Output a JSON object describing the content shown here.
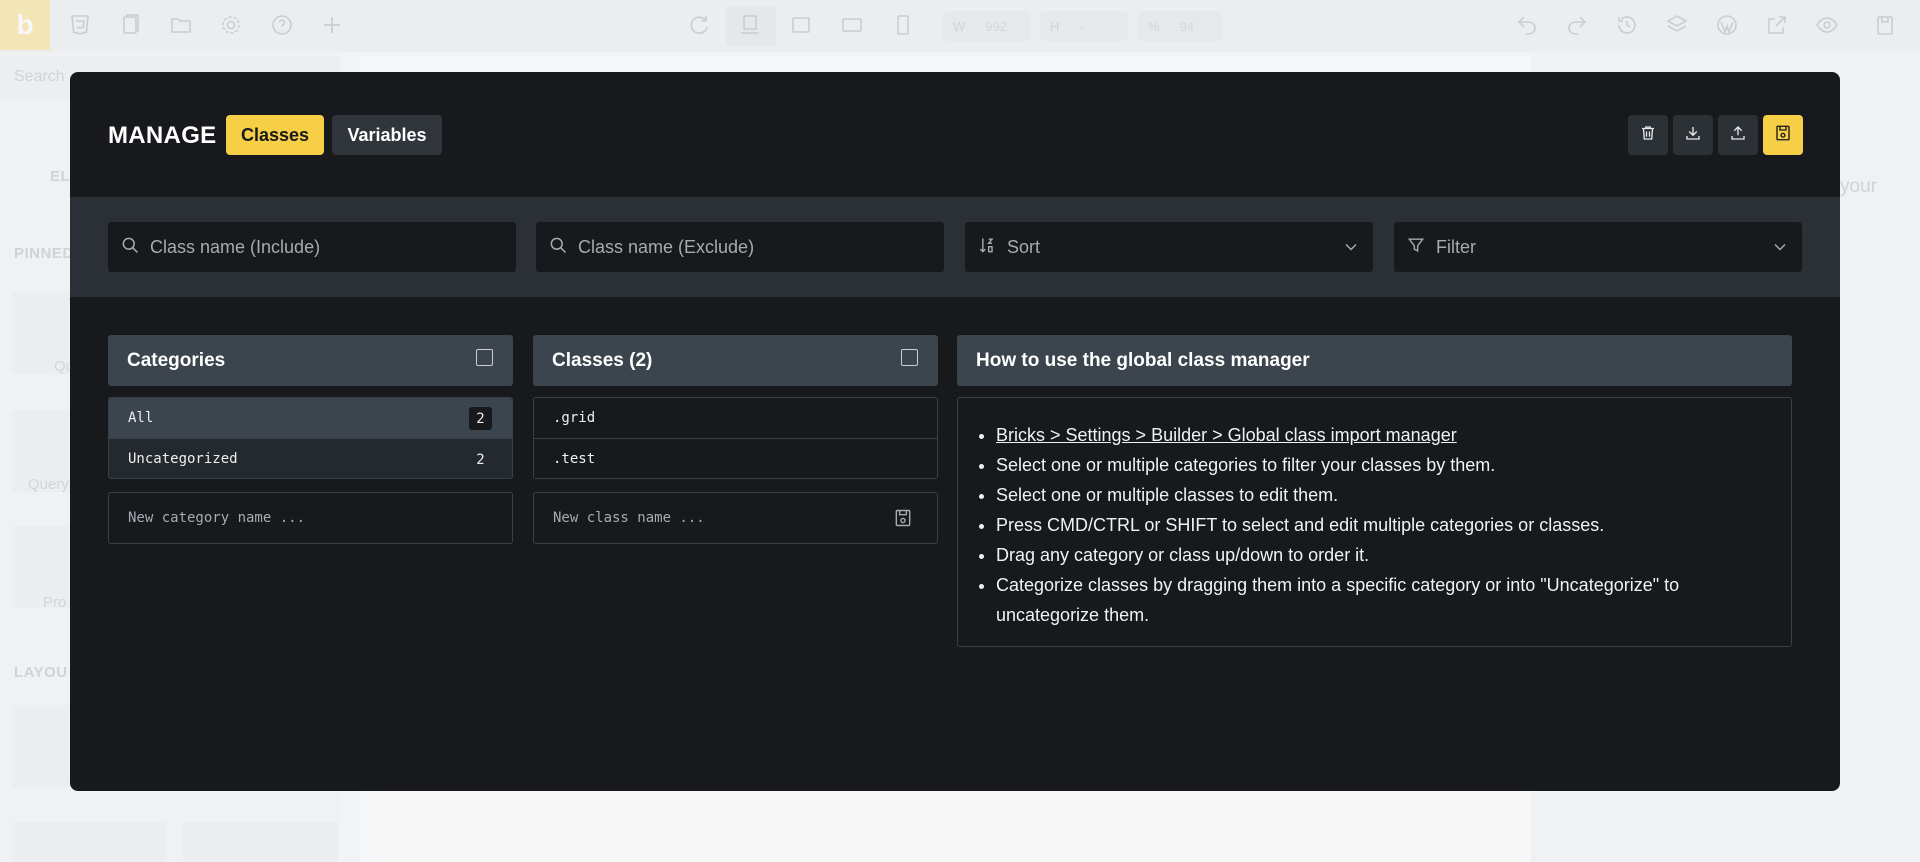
{
  "builder": {
    "logo": "b",
    "width_label": "W",
    "width_value": "992",
    "height_label": "H",
    "height_value": "-",
    "zoom_label": "%",
    "zoom_value": "94",
    "sidebar_search": "Search",
    "sidebar_labels": [
      "EL",
      "PINNED",
      "LAYOU"
    ],
    "sidebar_items": [
      "Qu",
      "Query",
      "Pro"
    ],
    "right_panel_text": "your"
  },
  "modal": {
    "title": "MANAGE",
    "tabs": [
      {
        "label": "Classes",
        "active": true
      },
      {
        "label": "Variables",
        "active": false
      }
    ],
    "header_buttons": [
      "trash-icon",
      "download-icon",
      "upload-icon",
      "save-icon"
    ],
    "accent_color": "#f6cf46"
  },
  "filters": {
    "include_placeholder": "Class name (Include)",
    "exclude_placeholder": "Class name (Exclude)",
    "sort_label": "Sort",
    "filter_label": "Filter"
  },
  "categories": {
    "title": "Categories",
    "items": [
      {
        "name": "All",
        "count": "2",
        "selected": true
      },
      {
        "name": "Uncategorized",
        "count": "2",
        "selected": false
      }
    ],
    "new_placeholder": "New category name ..."
  },
  "classes": {
    "title": "Classes (2)",
    "items": [
      ".grid",
      ".test"
    ],
    "new_placeholder": "New class name ..."
  },
  "help": {
    "title": "How to use the global class manager",
    "link": "Bricks > Settings > Builder > Global class import manager",
    "tips": [
      "Select one or multiple categories to filter your classes by them.",
      "Select one or multiple classes to edit them.",
      "Press CMD/CTRL or SHIFT to select and edit multiple categories or classes.",
      "Drag any category or class up/down to order it.",
      "Categorize classes by dragging them into a specific category or into \"Uncategorize\" to uncategorize them."
    ]
  }
}
